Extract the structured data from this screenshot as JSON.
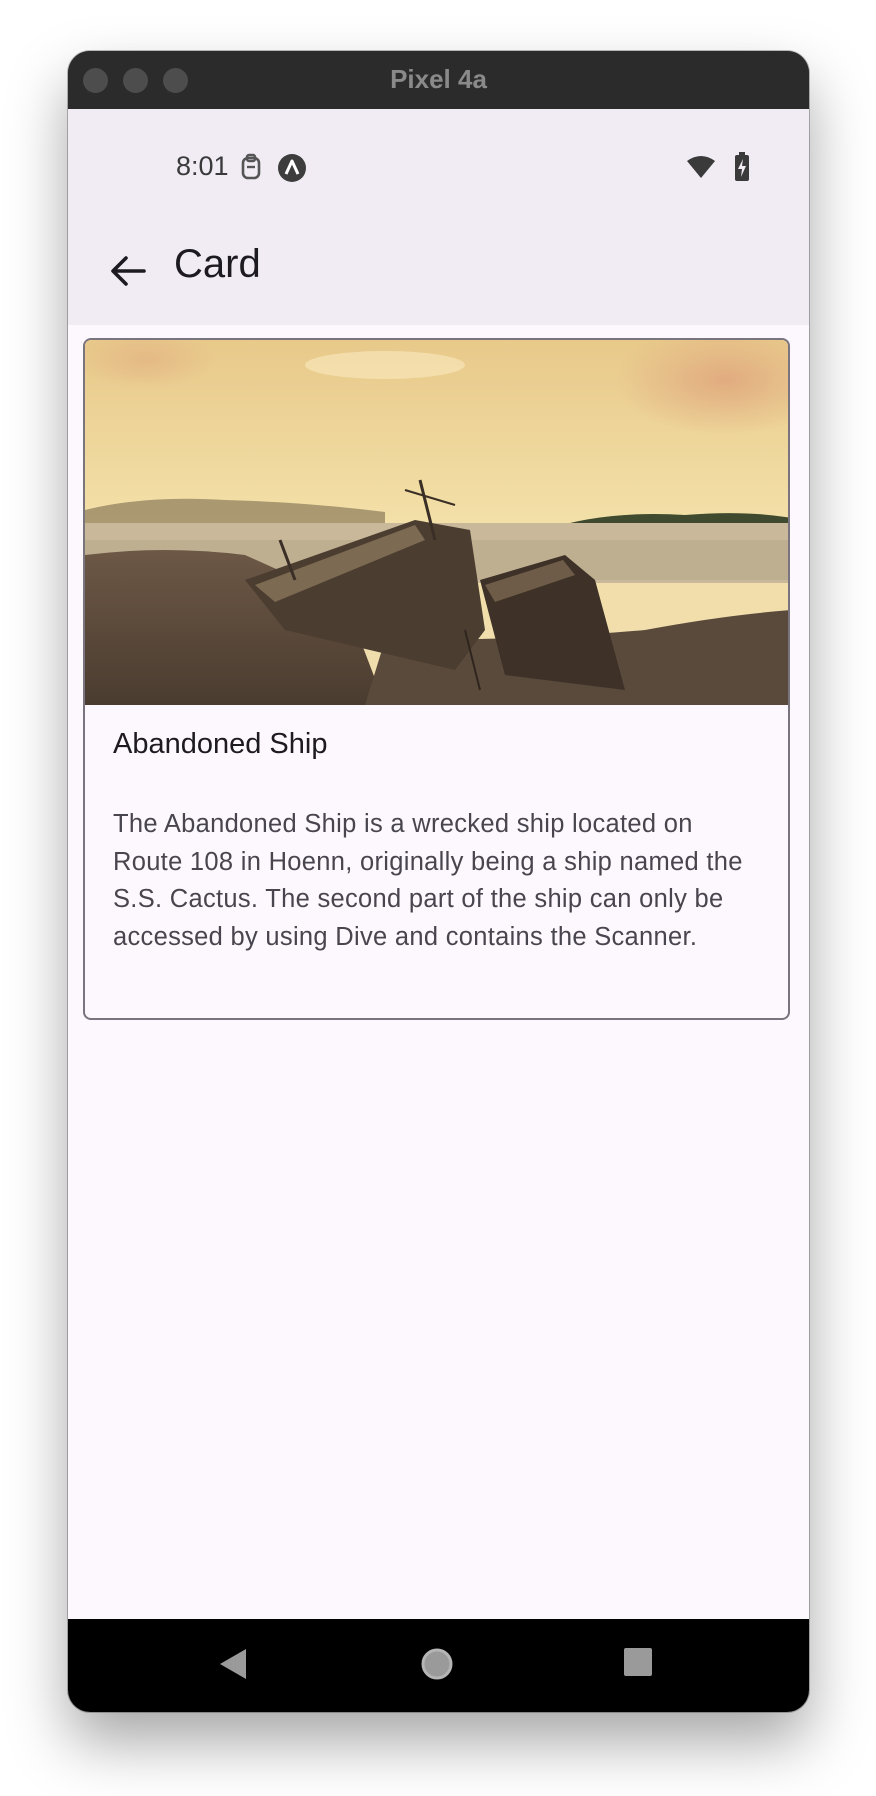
{
  "window": {
    "device_name": "Pixel 4a"
  },
  "status_bar": {
    "time": "8:01",
    "icons_left": [
      "clipboard-icon",
      "app-notification-icon"
    ],
    "icons_right": [
      "wifi-icon",
      "battery-charging-icon"
    ]
  },
  "top_bar": {
    "title": "Card",
    "back_icon": "arrow-back-icon"
  },
  "card": {
    "title": "Abandoned Ship",
    "body": "The Abandoned Ship is a wrecked ship located on Route 108 in Hoenn, originally being a ship named the S.S. Cactus. The second part of the ship can only be accessed by using Dive and contains the Scanner."
  },
  "nav_bar": {
    "buttons": [
      "back-triangle-icon",
      "home-circle-icon",
      "recents-square-icon"
    ]
  },
  "colors": {
    "app_bar_bg": "#f1ecf4",
    "surface": "#fdf8fd",
    "card_outline": "#79747e",
    "on_surface": "#1d1b20"
  }
}
